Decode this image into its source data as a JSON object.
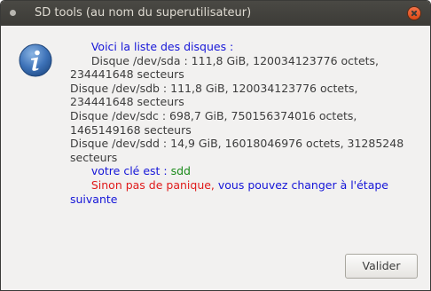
{
  "window": {
    "title": "SD tools (au nom du superutilisateur)"
  },
  "dialog": {
    "icon": "info-icon",
    "intro": "Voici la liste des disques :",
    "disk_lines": [
      "Disque /dev/sda : 111,8 GiB, 120034123776 octets,",
      "234441648 secteurs",
      "Disque /dev/sdb : 111,8 GiB, 120034123776 octets,",
      "234441648 secteurs",
      "Disque /dev/sdc : 698,7 GiB, 750156374016 octets,",
      "1465149168 secteurs",
      "Disque /dev/sdd : 14,9 GiB, 16018046976 octets, 31285248",
      "secteurs"
    ],
    "key_label": "votre clé est : ",
    "key_value": "sdd",
    "warning_red": "Sinon pas de panique,",
    "warning_blue_1": " vous pouvez changer à l'étape",
    "warning_blue_2": "suivante"
  },
  "buttons": {
    "ok_label": "Valider"
  },
  "colors": {
    "titlebar": "#3c3b37",
    "close_button": "#dd4814",
    "intro_text": "#1515d8",
    "key_value_text": "#1a8a1a",
    "warning_text": "#e01b1b"
  }
}
